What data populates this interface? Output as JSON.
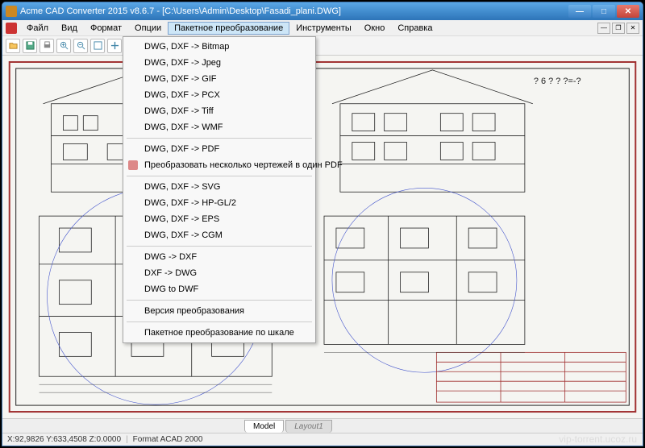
{
  "titlebar": {
    "title": "Acme CAD Converter 2015 v8.6.7 - [C:\\Users\\Admin\\Desktop\\Fasadi_plani.DWG]"
  },
  "menubar": {
    "items": [
      "Файл",
      "Вид",
      "Формат",
      "Опции",
      "Пакетное преобразование",
      "Инструменты",
      "Окно",
      "Справка"
    ],
    "active_index": 4
  },
  "dropdown": {
    "groups": [
      [
        "DWG, DXF -> Bitmap",
        "DWG, DXF -> Jpeg",
        "DWG, DXF -> GIF",
        "DWG, DXF -> PCX",
        "DWG, DXF -> Tiff",
        "DWG, DXF -> WMF"
      ],
      [
        "DWG, DXF -> PDF",
        "Преобразовать несколько чертежей в один PDF"
      ],
      [
        "DWG, DXF -> SVG",
        "DWG, DXF -> HP-GL/2",
        "DWG, DXF -> EPS",
        "DWG, DXF -> CGM"
      ],
      [
        "DWG -> DXF",
        "DXF -> DWG",
        "DWG to DWF"
      ],
      [
        "Версия преобразования"
      ],
      [
        "Пакетное преобразование по шкале"
      ]
    ],
    "icon_items": [
      "Преобразовать несколько чертежей в один PDF"
    ]
  },
  "tabs": {
    "model": "Model",
    "layout": "Layout1"
  },
  "statusbar": {
    "coords": "X:92,9826 Y:633,4508 Z:0.0000",
    "format": "Format ACAD 2000"
  },
  "drawing": {
    "top_right": "? 6 ? ? ?=-?"
  },
  "watermark": "vip-torrent.ucoz.ru"
}
